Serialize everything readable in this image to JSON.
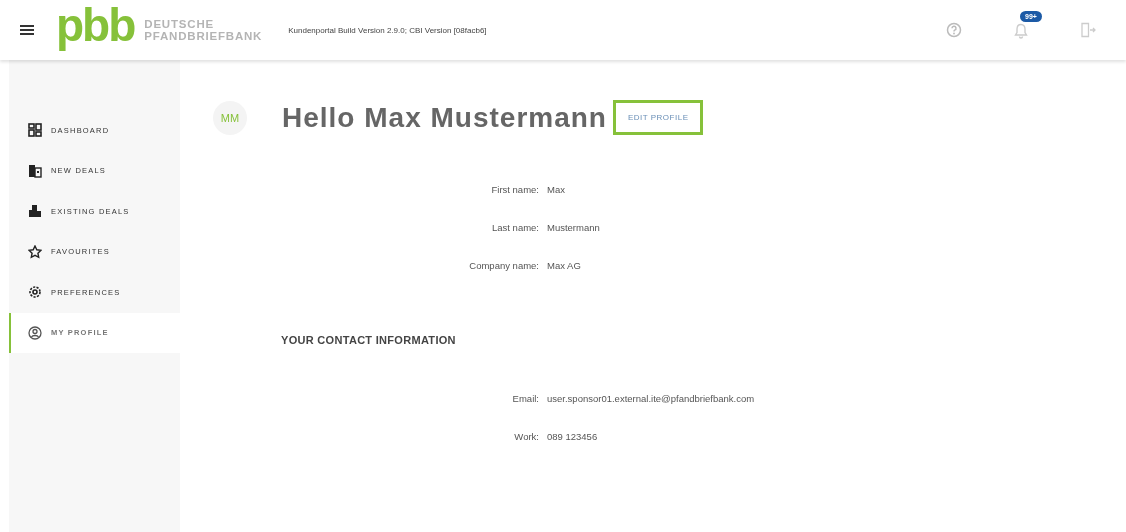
{
  "header": {
    "logo_mark": "pbb",
    "logo_line_1": "DEUTSCHE",
    "logo_line_2": "PFANDBRIEFBANK",
    "build_info": "Kundenportal Build Version 2.9.0; CBI Version [08facb6]",
    "notification_count": "99+"
  },
  "sidebar": {
    "items": [
      {
        "label": "DASHBOARD",
        "selected": false
      },
      {
        "label": "NEW DEALS",
        "selected": false
      },
      {
        "label": "EXISTING DEALS",
        "selected": false
      },
      {
        "label": "FAVOURITES",
        "selected": false
      },
      {
        "label": "PREFERENCES",
        "selected": false
      },
      {
        "label": "MY PROFILE",
        "selected": true
      }
    ]
  },
  "profile": {
    "initials": "MM",
    "greeting": "Hello Max Mustermann",
    "edit_button": "EDIT PROFILE",
    "fields": [
      {
        "label": "First name:",
        "value": "Max"
      },
      {
        "label": "Last name:",
        "value": "Mustermann"
      },
      {
        "label": "Company name:",
        "value": "Max AG"
      }
    ]
  },
  "contact": {
    "heading": "YOUR CONTACT INFORMATION",
    "fields": [
      {
        "label": "Email:",
        "value": "user.sponsor01.external.ite@pfandbriefbank.com"
      },
      {
        "label": "Work:",
        "value": "089 123456"
      }
    ]
  }
}
